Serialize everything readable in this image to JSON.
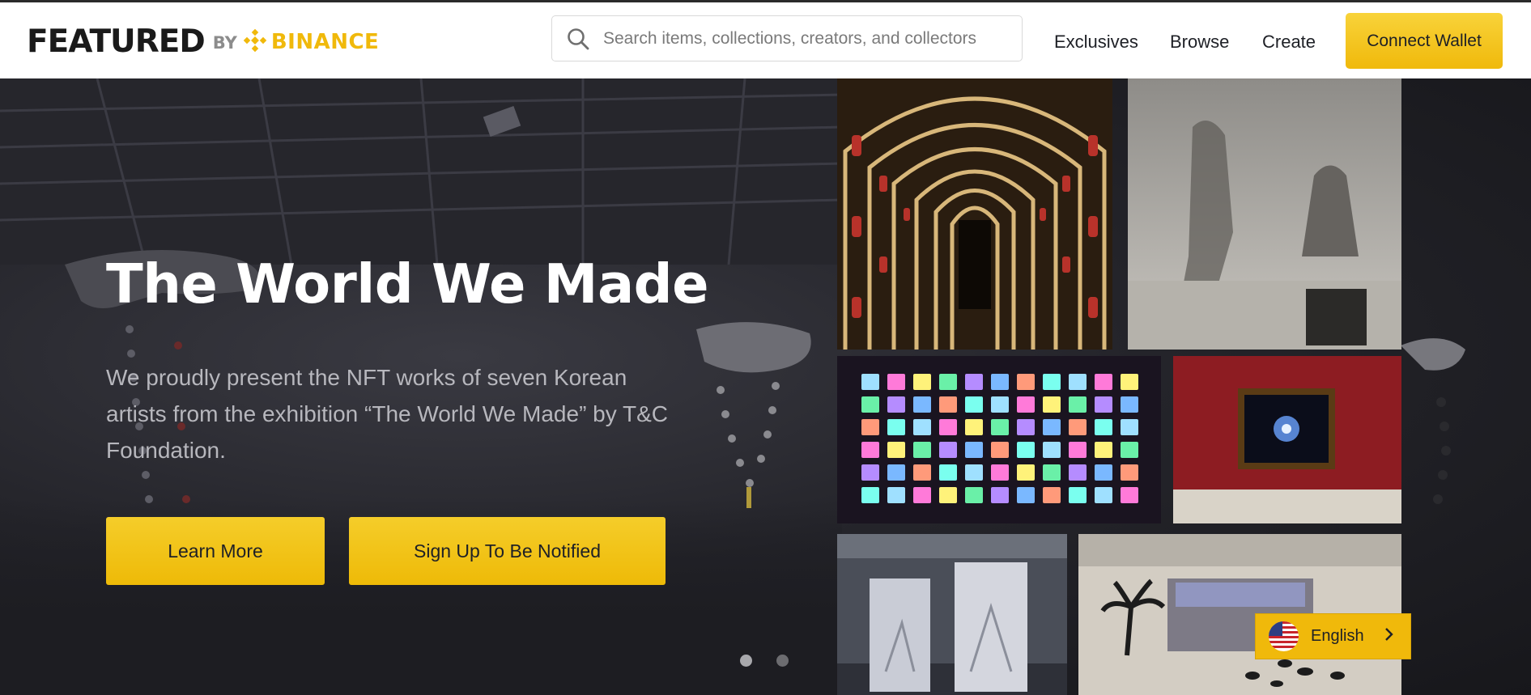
{
  "brand": {
    "wordmark": "FEATURED",
    "by": "BY",
    "partner": "BINANCE",
    "colors": {
      "accent": "#f0b90b",
      "text": "#1e2026"
    }
  },
  "search": {
    "placeholder": "Search items, collections, creators, and collectors",
    "icon": "search-icon"
  },
  "nav": {
    "links": [
      "Exclusives",
      "Browse",
      "Create"
    ],
    "connect_label": "Connect Wallet"
  },
  "hero": {
    "title": "The World We Made",
    "description": "We proudly present the NFT works of seven Korean artists from the exhibition “The World We Made” by T&C Foundation.",
    "learn_more": "Learn More",
    "notify": "Sign Up To Be Notified",
    "carousel": {
      "total": 2,
      "active": 1
    }
  },
  "language": {
    "label": "English",
    "flag_icon": "us-flag-icon",
    "chevron_icon": "chevron-right-icon"
  }
}
